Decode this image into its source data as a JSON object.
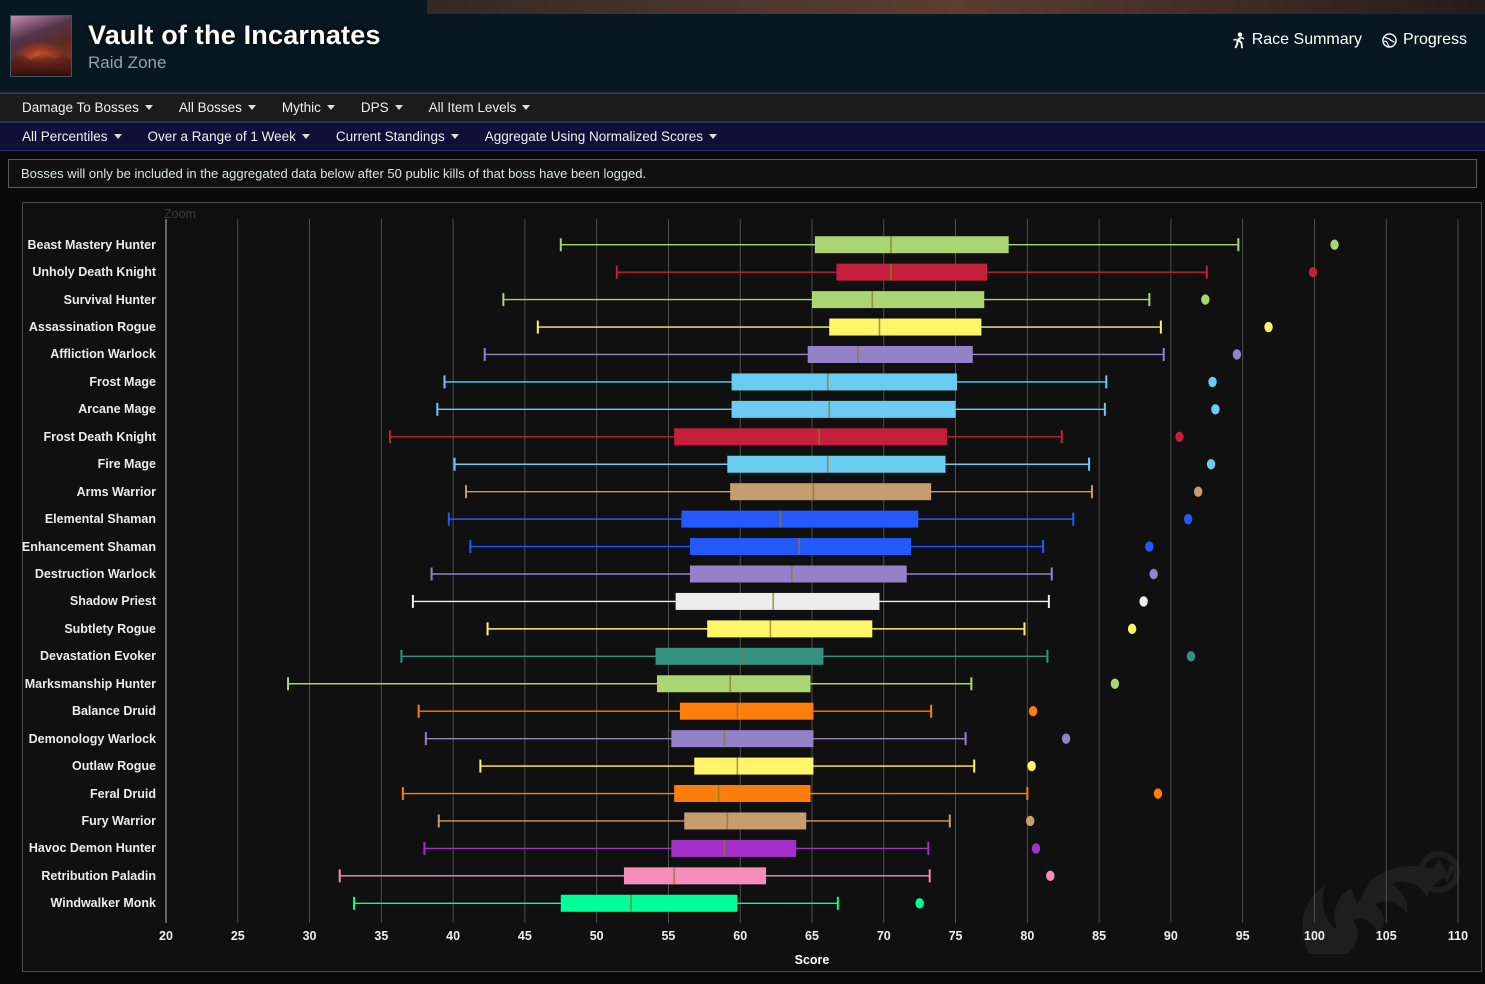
{
  "header": {
    "title": "Vault of the Incarnates",
    "subtitle": "Raid Zone",
    "links": [
      {
        "label": "Race Summary",
        "icon": "runner-icon"
      },
      {
        "label": "Progress",
        "icon": "globe-icon"
      }
    ]
  },
  "filters_row1": [
    {
      "label": "Damage To Bosses"
    },
    {
      "label": "All Bosses"
    },
    {
      "label": "Mythic"
    },
    {
      "label": "DPS"
    },
    {
      "label": "All Item Levels"
    }
  ],
  "filters_row2": [
    {
      "label": "All Percentiles"
    },
    {
      "label": "Over a Range of 1 Week"
    },
    {
      "label": "Current Standings"
    },
    {
      "label": "Aggregate Using Normalized Scores"
    }
  ],
  "notice": "Bosses will only be included in the aggregated data below after 50 public kills of that boss have been logged.",
  "chart_zoom_label": "Zoom",
  "chart_data": {
    "type": "box",
    "title": "",
    "xlabel": "Score",
    "ylabel": "",
    "xlim": [
      20,
      110
    ],
    "xticks": [
      20,
      25,
      30,
      35,
      40,
      45,
      50,
      55,
      60,
      65,
      70,
      75,
      80,
      85,
      90,
      95,
      100,
      105,
      110
    ],
    "grid": true,
    "legend": "none",
    "categories": [
      "Beast Mastery Hunter",
      "Unholy Death Knight",
      "Survival Hunter",
      "Assassination Rogue",
      "Affliction Warlock",
      "Frost Mage",
      "Arcane Mage",
      "Frost Death Knight",
      "Fire Mage",
      "Arms Warrior",
      "Elemental Shaman",
      "Enhancement Shaman",
      "Destruction Warlock",
      "Shadow Priest",
      "Subtlety Rogue",
      "Devastation Evoker",
      "Marksmanship Hunter",
      "Balance Druid",
      "Demonology Warlock",
      "Outlaw Rogue",
      "Feral Druid",
      "Fury Warrior",
      "Havoc Demon Hunter",
      "Retribution Paladin",
      "Windwalker Monk"
    ],
    "boxes": [
      {
        "name": "Beast Mastery Hunter",
        "color": "#abd473",
        "min": 47.5,
        "q1": 65.2,
        "median": 70.5,
        "q3": 78.7,
        "max": 94.7,
        "outlier": 101.4
      },
      {
        "name": "Unholy Death Knight",
        "color": "#c41f3b",
        "min": 51.4,
        "q1": 66.7,
        "median": 70.5,
        "q3": 77.2,
        "max": 92.5,
        "outlier": 99.9
      },
      {
        "name": "Survival Hunter",
        "color": "#abd473",
        "min": 43.5,
        "q1": 65.0,
        "median": 69.2,
        "q3": 77.0,
        "max": 88.5,
        "outlier": 92.4
      },
      {
        "name": "Assassination Rogue",
        "color": "#fff569",
        "min": 45.9,
        "q1": 66.2,
        "median": 69.7,
        "q3": 76.8,
        "max": 89.3,
        "outlier": 96.8
      },
      {
        "name": "Affliction Warlock",
        "color": "#9482c9",
        "min": 42.2,
        "q1": 64.7,
        "median": 68.2,
        "q3": 76.2,
        "max": 89.5,
        "outlier": 94.6
      },
      {
        "name": "Frost Mage",
        "color": "#69ccf0",
        "min": 39.4,
        "q1": 59.4,
        "median": 66.1,
        "q3": 75.1,
        "max": 85.5,
        "outlier": 92.9
      },
      {
        "name": "Arcane Mage",
        "color": "#69ccf0",
        "min": 38.9,
        "q1": 59.4,
        "median": 66.2,
        "q3": 75.0,
        "max": 85.4,
        "outlier": 93.1
      },
      {
        "name": "Frost Death Knight",
        "color": "#c41f3b",
        "min": 35.6,
        "q1": 55.4,
        "median": 65.5,
        "q3": 74.4,
        "max": 82.4,
        "outlier": 90.6
      },
      {
        "name": "Fire Mage",
        "color": "#69ccf0",
        "min": 40.1,
        "q1": 59.1,
        "median": 66.1,
        "q3": 74.3,
        "max": 84.3,
        "outlier": 92.8
      },
      {
        "name": "Arms Warrior",
        "color": "#c79c6e",
        "min": 40.9,
        "q1": 59.3,
        "median": 65.1,
        "q3": 73.3,
        "max": 84.5,
        "outlier": 91.9
      },
      {
        "name": "Elemental Shaman",
        "color": "#2459ff",
        "min": 39.7,
        "q1": 55.9,
        "median": 62.8,
        "q3": 72.4,
        "max": 83.2,
        "outlier": 91.2
      },
      {
        "name": "Enhancement Shaman",
        "color": "#2459ff",
        "min": 41.2,
        "q1": 56.5,
        "median": 64.1,
        "q3": 71.9,
        "max": 81.1,
        "outlier": 88.5
      },
      {
        "name": "Destruction Warlock",
        "color": "#9482c9",
        "min": 38.5,
        "q1": 56.5,
        "median": 63.6,
        "q3": 71.6,
        "max": 81.7,
        "outlier": 88.8
      },
      {
        "name": "Shadow Priest",
        "color": "#ededed",
        "min": 37.2,
        "q1": 55.5,
        "median": 62.3,
        "q3": 69.7,
        "max": 81.5,
        "outlier": 88.1
      },
      {
        "name": "Subtlety Rogue",
        "color": "#fff569",
        "min": 42.4,
        "q1": 57.7,
        "median": 62.1,
        "q3": 69.2,
        "max": 79.8,
        "outlier": 87.3
      },
      {
        "name": "Devastation Evoker",
        "color": "#33937f",
        "min": 36.4,
        "q1": 54.1,
        "median": 60.1,
        "q3": 65.8,
        "max": 81.4,
        "outlier": 91.4
      },
      {
        "name": "Marksmanship Hunter",
        "color": "#abd473",
        "min": 28.5,
        "q1": 54.2,
        "median": 59.3,
        "q3": 64.9,
        "max": 76.1,
        "outlier": 86.1
      },
      {
        "name": "Balance Druid",
        "color": "#ff7d0a",
        "min": 37.6,
        "q1": 55.8,
        "median": 59.8,
        "q3": 65.1,
        "max": 73.3,
        "outlier": 80.4
      },
      {
        "name": "Demonology Warlock",
        "color": "#9482c9",
        "min": 38.1,
        "q1": 55.2,
        "median": 58.9,
        "q3": 65.1,
        "max": 75.7,
        "outlier": 82.7
      },
      {
        "name": "Outlaw Rogue",
        "color": "#fff569",
        "min": 41.9,
        "q1": 56.8,
        "median": 59.8,
        "q3": 65.1,
        "max": 76.3,
        "outlier": 80.3
      },
      {
        "name": "Feral Druid",
        "color": "#ff7d0a",
        "min": 36.5,
        "q1": 55.4,
        "median": 58.5,
        "q3": 64.9,
        "max": 80.0,
        "outlier": 89.1
      },
      {
        "name": "Fury Warrior",
        "color": "#c79c6e",
        "min": 39.0,
        "q1": 56.1,
        "median": 59.1,
        "q3": 64.6,
        "max": 74.6,
        "outlier": 80.2
      },
      {
        "name": "Havoc Demon Hunter",
        "color": "#a330c9",
        "min": 38.0,
        "q1": 55.2,
        "median": 58.9,
        "q3": 63.9,
        "max": 73.1,
        "outlier": 80.6
      },
      {
        "name": "Retribution Paladin",
        "color": "#f58cba",
        "min": 32.1,
        "q1": 51.9,
        "median": 55.4,
        "q3": 61.8,
        "max": 73.2,
        "outlier": 81.6
      },
      {
        "name": "Windwalker Monk",
        "color": "#00ff96",
        "min": 33.1,
        "q1": 47.5,
        "median": 52.4,
        "q3": 59.8,
        "max": 66.8,
        "outlier": 72.5
      }
    ]
  }
}
